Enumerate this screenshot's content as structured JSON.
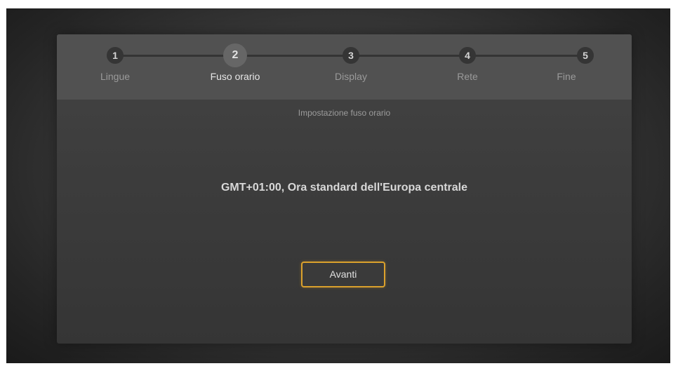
{
  "wizard": {
    "steps": [
      {
        "number": "1",
        "label": "Lingue",
        "active": false
      },
      {
        "number": "2",
        "label": "Fuso orario",
        "active": true
      },
      {
        "number": "3",
        "label": "Display",
        "active": false
      },
      {
        "number": "4",
        "label": "Rete",
        "active": false
      },
      {
        "number": "5",
        "label": "Fine",
        "active": false
      }
    ],
    "current_step": 2,
    "total_steps": 5
  },
  "content": {
    "subtitle": "Impostazione fuso orario",
    "timezone_value": "GMT+01:00, Ora standard dell'Europa centrale",
    "next_button_label": "Avanti"
  },
  "colors": {
    "accent_focus": "#dba12c",
    "panel_background": "#3d3d3d",
    "stepper_background": "#515151"
  }
}
